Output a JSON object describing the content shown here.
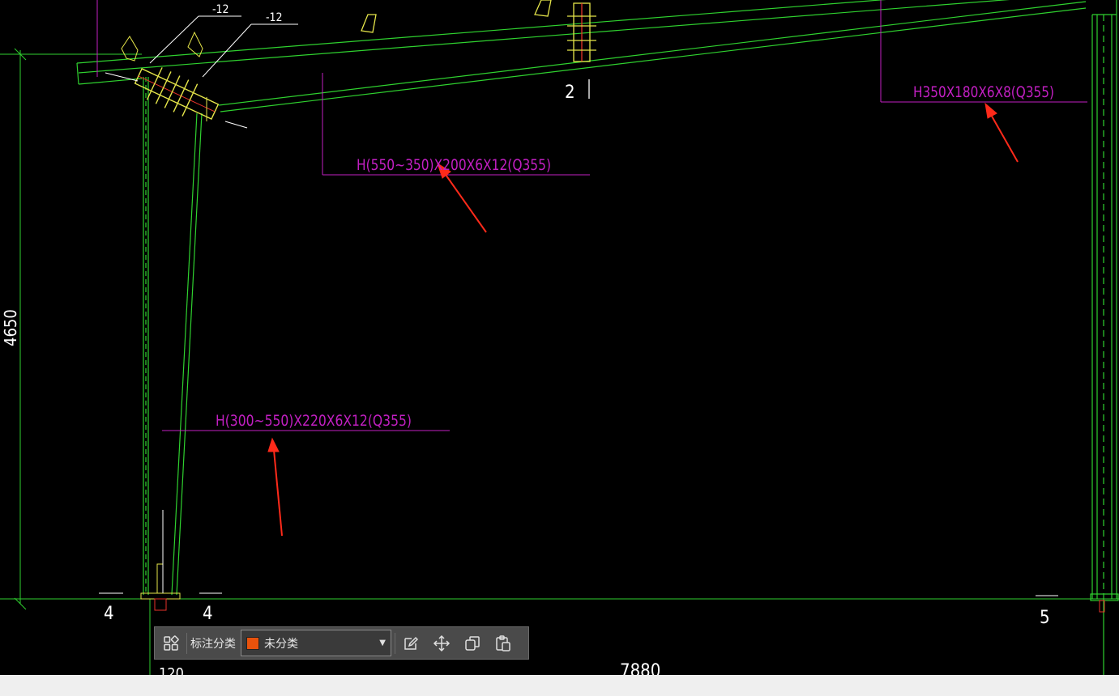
{
  "drawing": {
    "labels": {
      "beam_spec": "H(550~350)X200X6X12(Q355)",
      "column_spec": "H(300~550)X220X6X12(Q355)",
      "rafter_spec": "H350X180X6X8(Q355)",
      "plate_a": "-12",
      "plate_b": "-12",
      "section_mark": "2",
      "dim_height": "4650",
      "dim_span": "7880",
      "dim_base": "120",
      "axis_left_a": "4",
      "axis_left_b": "4",
      "axis_right": "5"
    },
    "colors": {
      "member": "#2fd12f",
      "annotation": "#c21fc2",
      "detail": "#e6e64a",
      "arrow": "#ff2a1a",
      "text_white": "#ffffff"
    }
  },
  "toolbar": {
    "label": "标注分类",
    "category_value": "未分类",
    "category_color": "#e8520c",
    "icons": [
      "category-grid-icon",
      "edit-icon",
      "move-icon",
      "copy-icon",
      "paste-icon"
    ]
  }
}
